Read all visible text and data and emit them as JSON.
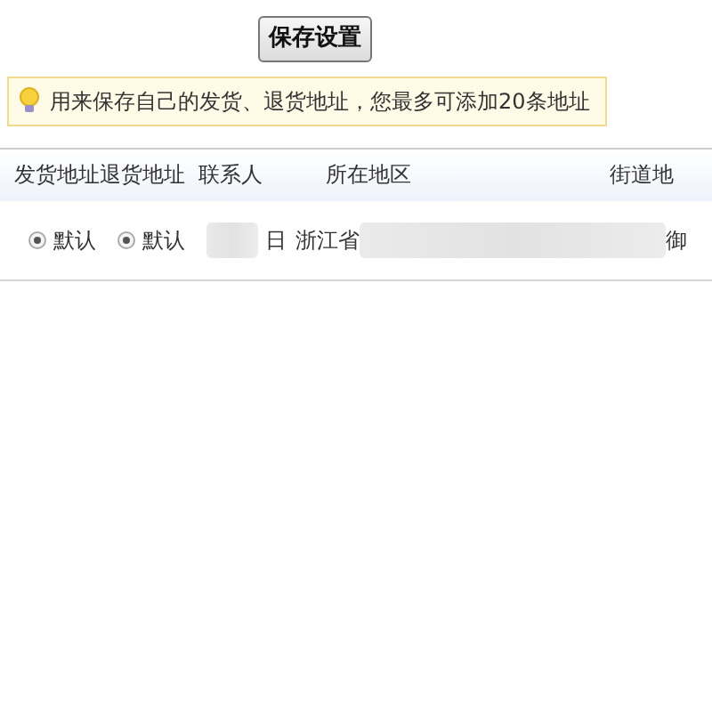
{
  "save_button": {
    "label": "保存设置"
  },
  "tip": {
    "text": "用来保存自己的发货、退货地址，您最多可添加20条地址"
  },
  "table": {
    "columns": [
      "发货地址",
      "退货地址",
      "联系人",
      "所在地区",
      "街道地"
    ],
    "rows": [
      {
        "ship_default": {
          "label": "默认",
          "checked": true
        },
        "return_default": {
          "label": "默认",
          "checked": true
        },
        "contact": "日",
        "region": "浙江省",
        "street": "御"
      }
    ]
  }
}
